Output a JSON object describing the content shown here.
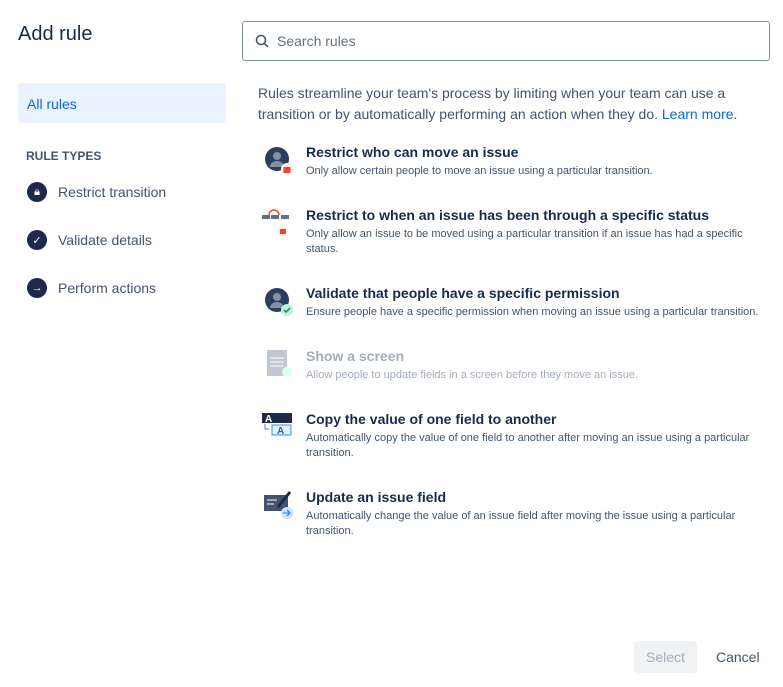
{
  "title": "Add rule",
  "search": {
    "placeholder": "Search rules"
  },
  "sidebar": {
    "all_rules": "All rules",
    "section": "RULE TYPES",
    "items": [
      {
        "label": "Restrict transition",
        "icon": "lock-icon"
      },
      {
        "label": "Validate details",
        "icon": "check-icon"
      },
      {
        "label": "Perform actions",
        "icon": "arrow-right-icon"
      }
    ]
  },
  "intro": {
    "text": "Rules streamline your team's process by limiting when your team can use a transition or by automatically performing an action when they do. ",
    "link": "Learn more",
    "end": "."
  },
  "rules": [
    {
      "title": "Restrict who can move an issue",
      "desc": "Only allow certain people to move an issue using a particular transition."
    },
    {
      "title": "Restrict to when an issue has been through a specific status",
      "desc": "Only allow an issue to be moved using a particular transition if an issue has had a specific status."
    },
    {
      "title": "Validate that people have a specific permission",
      "desc": "Ensure people have a specific permission when moving an issue using a particular transition."
    },
    {
      "title": "Show a screen",
      "desc": "Allow people to update fields in a screen before they move an issue."
    },
    {
      "title": "Copy the value of one field to another",
      "desc": "Automatically copy the value of one field to another after moving an issue using a particular transition."
    },
    {
      "title": "Update an issue field",
      "desc": "Automatically change the value of an issue field after moving the issue using a particular transition."
    }
  ],
  "footer": {
    "select": "Select",
    "cancel": "Cancel"
  }
}
